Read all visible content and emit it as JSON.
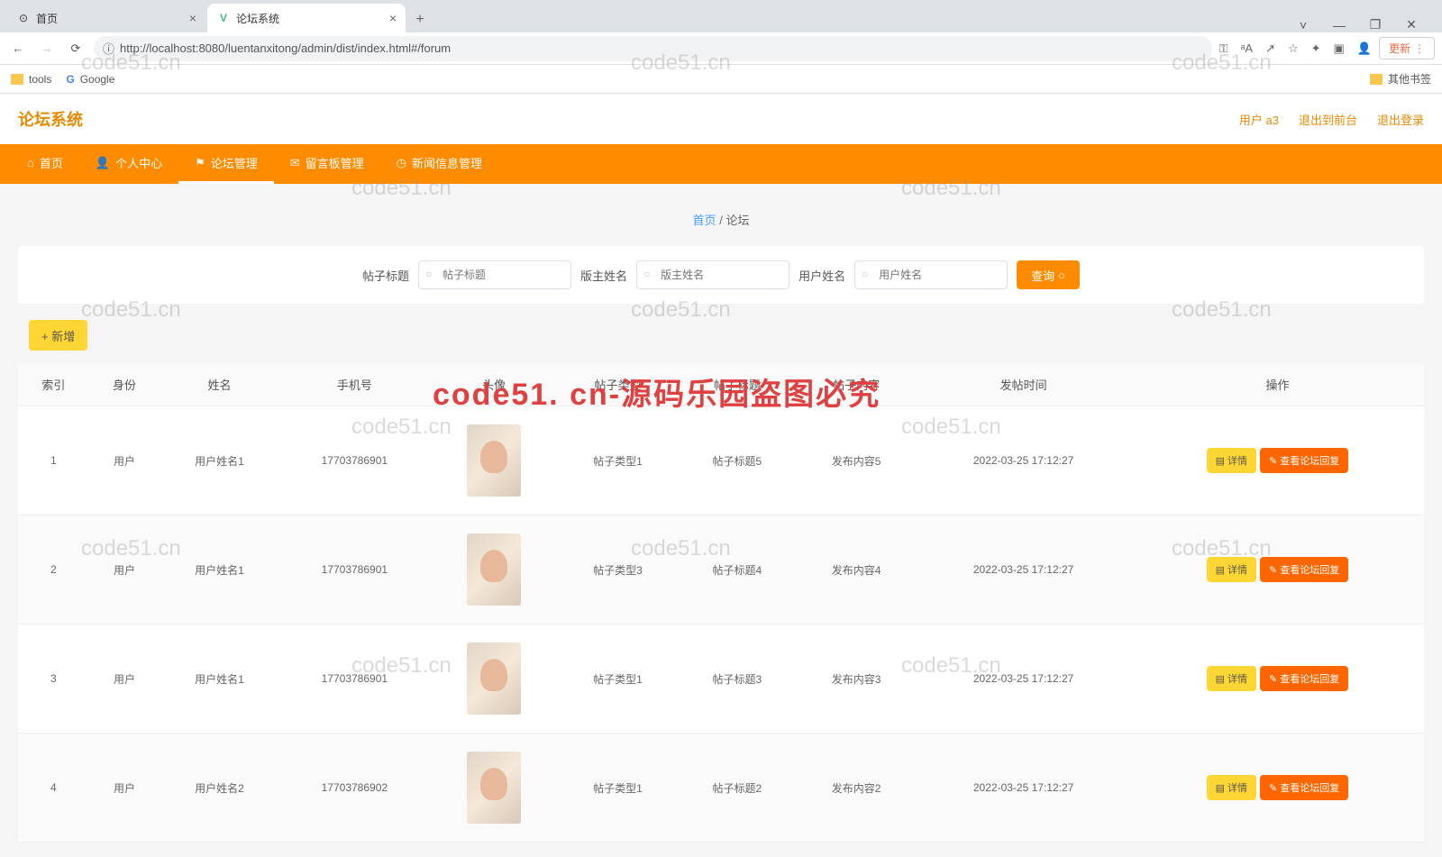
{
  "browser": {
    "tabs": [
      {
        "title": "首页",
        "icon": "⊙",
        "active": false
      },
      {
        "title": "论坛系统",
        "icon": "V",
        "active": true
      }
    ],
    "url": "http://localhost:8080/luentanxitong/admin/dist/index.html#/forum",
    "url_prefix": "ⓘ",
    "update_btn": "更新",
    "bookmarks": {
      "tools": "tools",
      "google": "Google",
      "other": "其他书签"
    }
  },
  "header": {
    "logo": "论坛系统",
    "user": "用户 a3",
    "exit_front": "退出到前台",
    "logout": "退出登录"
  },
  "nav": [
    "首页",
    "个人中心",
    "论坛管理",
    "留言板管理",
    "新闻信息管理"
  ],
  "breadcrumb": {
    "home": "首页",
    "sep": "/",
    "current": "论坛"
  },
  "search": {
    "title_label": "帖子标题",
    "title_ph": "帖子标题",
    "mod_label": "版主姓名",
    "mod_ph": "版主姓名",
    "user_label": "用户姓名",
    "user_ph": "用户姓名",
    "query": "查询"
  },
  "add_btn": "+ 新增",
  "columns": [
    "索引",
    "身份",
    "姓名",
    "手机号",
    "头像",
    "帖子类型",
    "帖子标题",
    "帖子内容",
    "发帖时间",
    "操作"
  ],
  "rows": [
    {
      "idx": "1",
      "role": "用户",
      "name": "用户姓名1",
      "phone": "17703786901",
      "type": "帖子类型1",
      "title": "帖子标题5",
      "content": "发布内容5",
      "time": "2022-03-25 17:12:27"
    },
    {
      "idx": "2",
      "role": "用户",
      "name": "用户姓名1",
      "phone": "17703786901",
      "type": "帖子类型3",
      "title": "帖子标题4",
      "content": "发布内容4",
      "time": "2022-03-25 17:12:27"
    },
    {
      "idx": "3",
      "role": "用户",
      "name": "用户姓名1",
      "phone": "17703786901",
      "type": "帖子类型1",
      "title": "帖子标题3",
      "content": "发布内容3",
      "time": "2022-03-25 17:12:27"
    },
    {
      "idx": "4",
      "role": "用户",
      "name": "用户姓名2",
      "phone": "17703786902",
      "type": "帖子类型1",
      "title": "帖子标题2",
      "content": "发布内容2",
      "time": "2022-03-25 17:12:27"
    }
  ],
  "action": {
    "detail": "详情",
    "reply": "查看论坛回复"
  },
  "watermark_text": "code51.cn",
  "watermark_red": "code51. cn-源码乐园盗图必究"
}
